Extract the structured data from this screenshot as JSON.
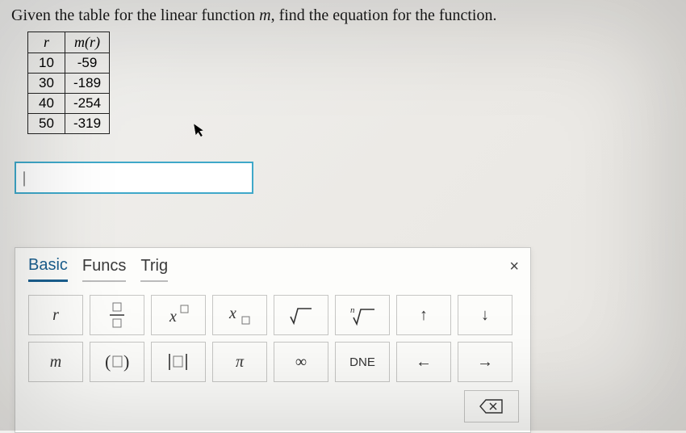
{
  "prompt": {
    "prefix": "Given the table for the linear function ",
    "fn": "m",
    "suffix": ", find the equation for the function."
  },
  "table": {
    "header_r": "r",
    "header_m": "m(r)",
    "rows": [
      {
        "r": "10",
        "m": "-59"
      },
      {
        "r": "30",
        "m": "-189"
      },
      {
        "r": "40",
        "m": "-254"
      },
      {
        "r": "50",
        "m": "-319"
      }
    ]
  },
  "input_value": "|",
  "keypad": {
    "tabs": {
      "basic": "Basic",
      "funcs": "Funcs",
      "trig": "Trig"
    },
    "close": "×",
    "keys": {
      "r": "r",
      "m": "m",
      "pi": "π",
      "inf": "∞",
      "dne": "DNE",
      "up": "↑",
      "down": "↓",
      "left": "←",
      "right": "→",
      "backspace": "⌫"
    }
  }
}
